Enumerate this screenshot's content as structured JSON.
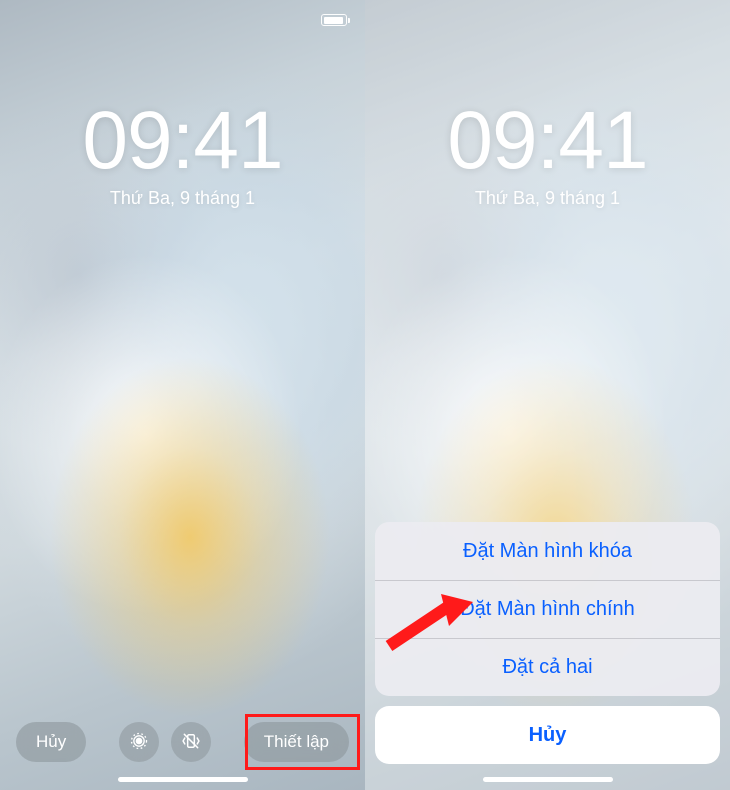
{
  "left": {
    "time": "09:41",
    "date": "Thứ Ba, 9 tháng 1",
    "cancel": "Hủy",
    "setup": "Thiết lập"
  },
  "right": {
    "time": "09:41",
    "date": "Thứ Ba, 9 tháng 1",
    "sheet": {
      "lock": "Đặt Màn hình khóa",
      "home": "Đặt Màn hình chính",
      "both": "Đặt cả hai",
      "cancel": "Hủy"
    }
  }
}
